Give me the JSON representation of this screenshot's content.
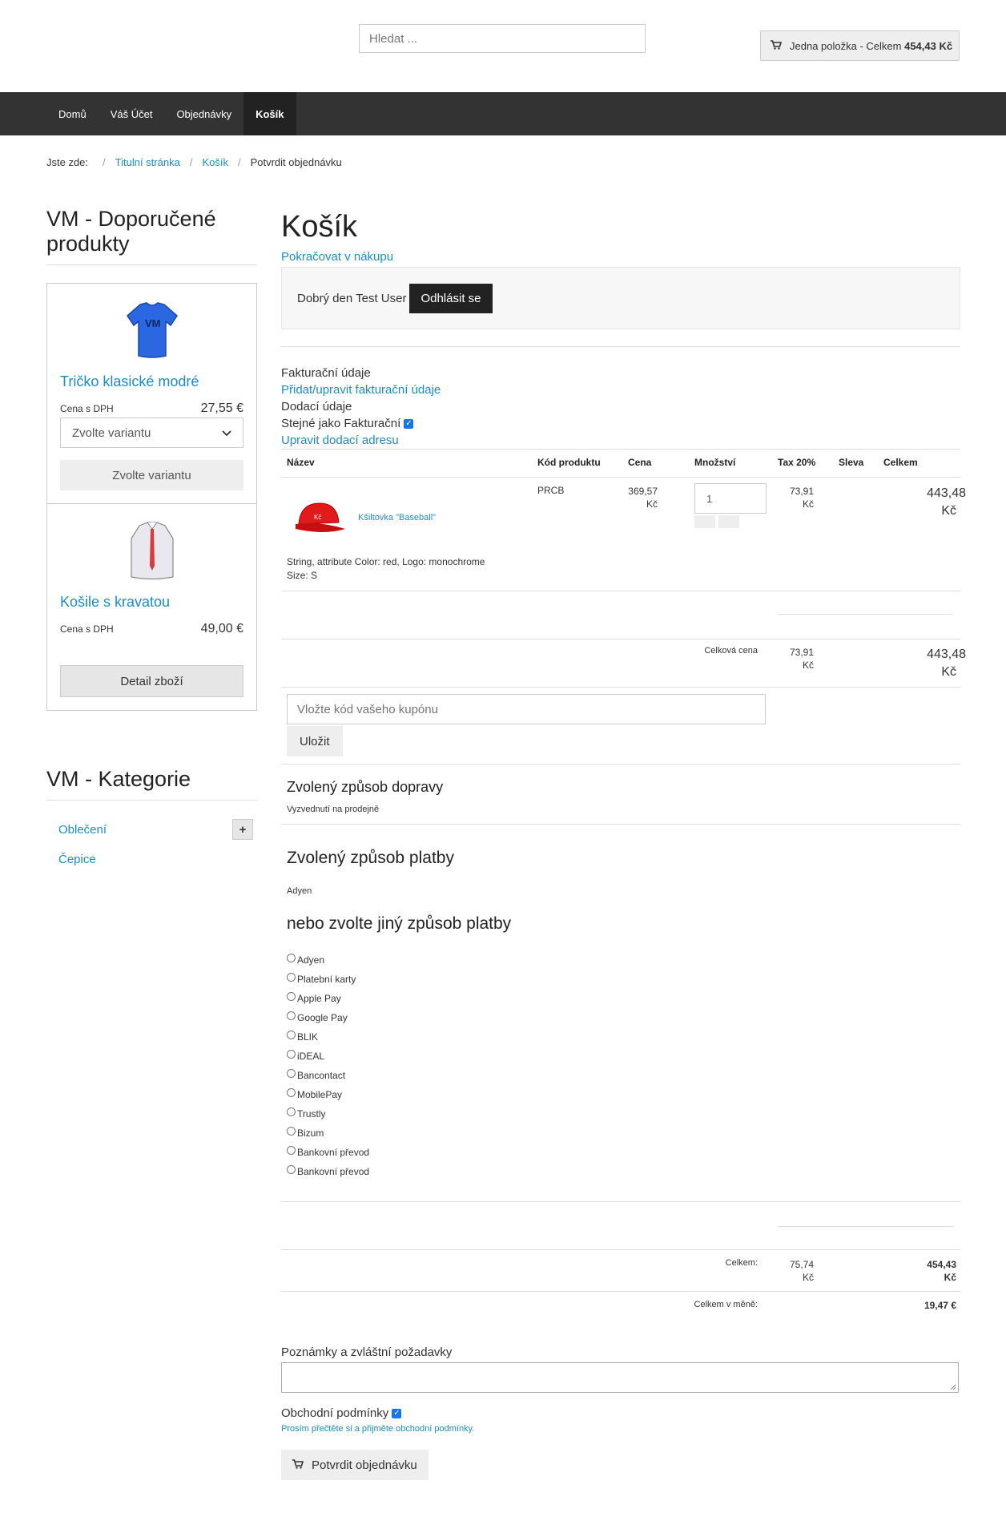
{
  "header": {
    "search_placeholder": "Hledat ...",
    "cart_label": "Jedna položka - Celkem",
    "cart_total": "454,43 Kč"
  },
  "nav": [
    {
      "label": "Domů",
      "active": false
    },
    {
      "label": "Váš Účet",
      "active": false
    },
    {
      "label": "Objednávky",
      "active": false
    },
    {
      "label": "Košík",
      "active": true
    }
  ],
  "breadcrumb": {
    "prefix": "Jste zde:",
    "items": [
      "Titulní stránka",
      "Košík",
      "Potvrdit objednávku"
    ]
  },
  "sidebar": {
    "featured_title": "VM - Doporučené produkty",
    "products": [
      {
        "name": "Tričko klasické modré",
        "price_label": "Cena s DPH",
        "price": "27,55 €",
        "select": "Zvolte variantu",
        "button": "Zvolte variantu"
      },
      {
        "name": "Košile s kravatou",
        "price_label": "Cena s DPH",
        "price": "49,00 €",
        "button": "Detail zboží"
      }
    ],
    "categories_title": "VM - Kategorie",
    "categories": [
      "Oblečení",
      "Čepice"
    ]
  },
  "main": {
    "title": "Košík",
    "continue_link": "Pokračovat v nákupu",
    "greeting": "Dobrý den Test User",
    "logout": "Odhlásit se",
    "billing_label": "Fakturační údaje",
    "billing_link": "Přidat/upravit fakturační údaje",
    "shipping_label": "Dodací údaje",
    "same_as_billing": "Stejné jako Fakturační",
    "shipping_link": "Upravit dodací adresu",
    "table_headers": [
      "Název",
      "Kód produktu",
      "Cena",
      "Množství",
      "Tax 20%",
      "Sleva",
      "Celkem"
    ],
    "item": {
      "name": "Kšiltovka \"Baseball\"",
      "attrs": "String, attribute Color: red, Logo: monochrome",
      "size": "Size: S",
      "sku": "PRCB",
      "price": "369,57",
      "price_cur": "Kč",
      "qty": "1",
      "tax": "73,91",
      "tax_cur": "Kč",
      "total": "443,48",
      "total_cur": "Kč"
    },
    "subtotal": {
      "label": "Celková cena",
      "tax": "73,91",
      "tax_cur": "Kč",
      "total": "443,48",
      "total_cur": "Kč"
    },
    "coupon_placeholder": "Vložte kód vašeho kupónu",
    "coupon_button": "Uložit",
    "shipping_title": "Zvolený způsob dopravy",
    "shipping_method": "Vyzvednutí na prodejně",
    "payment_title": "Zvolený způsob platby",
    "payment_method": "Adyen",
    "alt_payment_title": "nebo zvolte jiný způsob platby",
    "payment_options": [
      "Adyen",
      "Platební karty",
      "Apple Pay",
      "Google Pay",
      "BLIK",
      "iDEAL",
      "Bancontact",
      "MobilePay",
      "Trustly",
      "Bizum",
      "Bankovní převod",
      "Bankovní převod"
    ],
    "total": {
      "label": "Celkem:",
      "tax": "75,74",
      "tax_cur": "Kč",
      "total": "454,43",
      "total_cur": "Kč"
    },
    "currency_total": {
      "label": "Celkem v měně:",
      "value": "19,47 €"
    },
    "notes_label": "Poznámky a zvláštní požadavky",
    "terms_label": "Obchodní podmínky",
    "terms_link": "Prosím přečtěte si a přijměte obchodní podmínky.",
    "confirm_button": "Potvrdit objednávku"
  }
}
